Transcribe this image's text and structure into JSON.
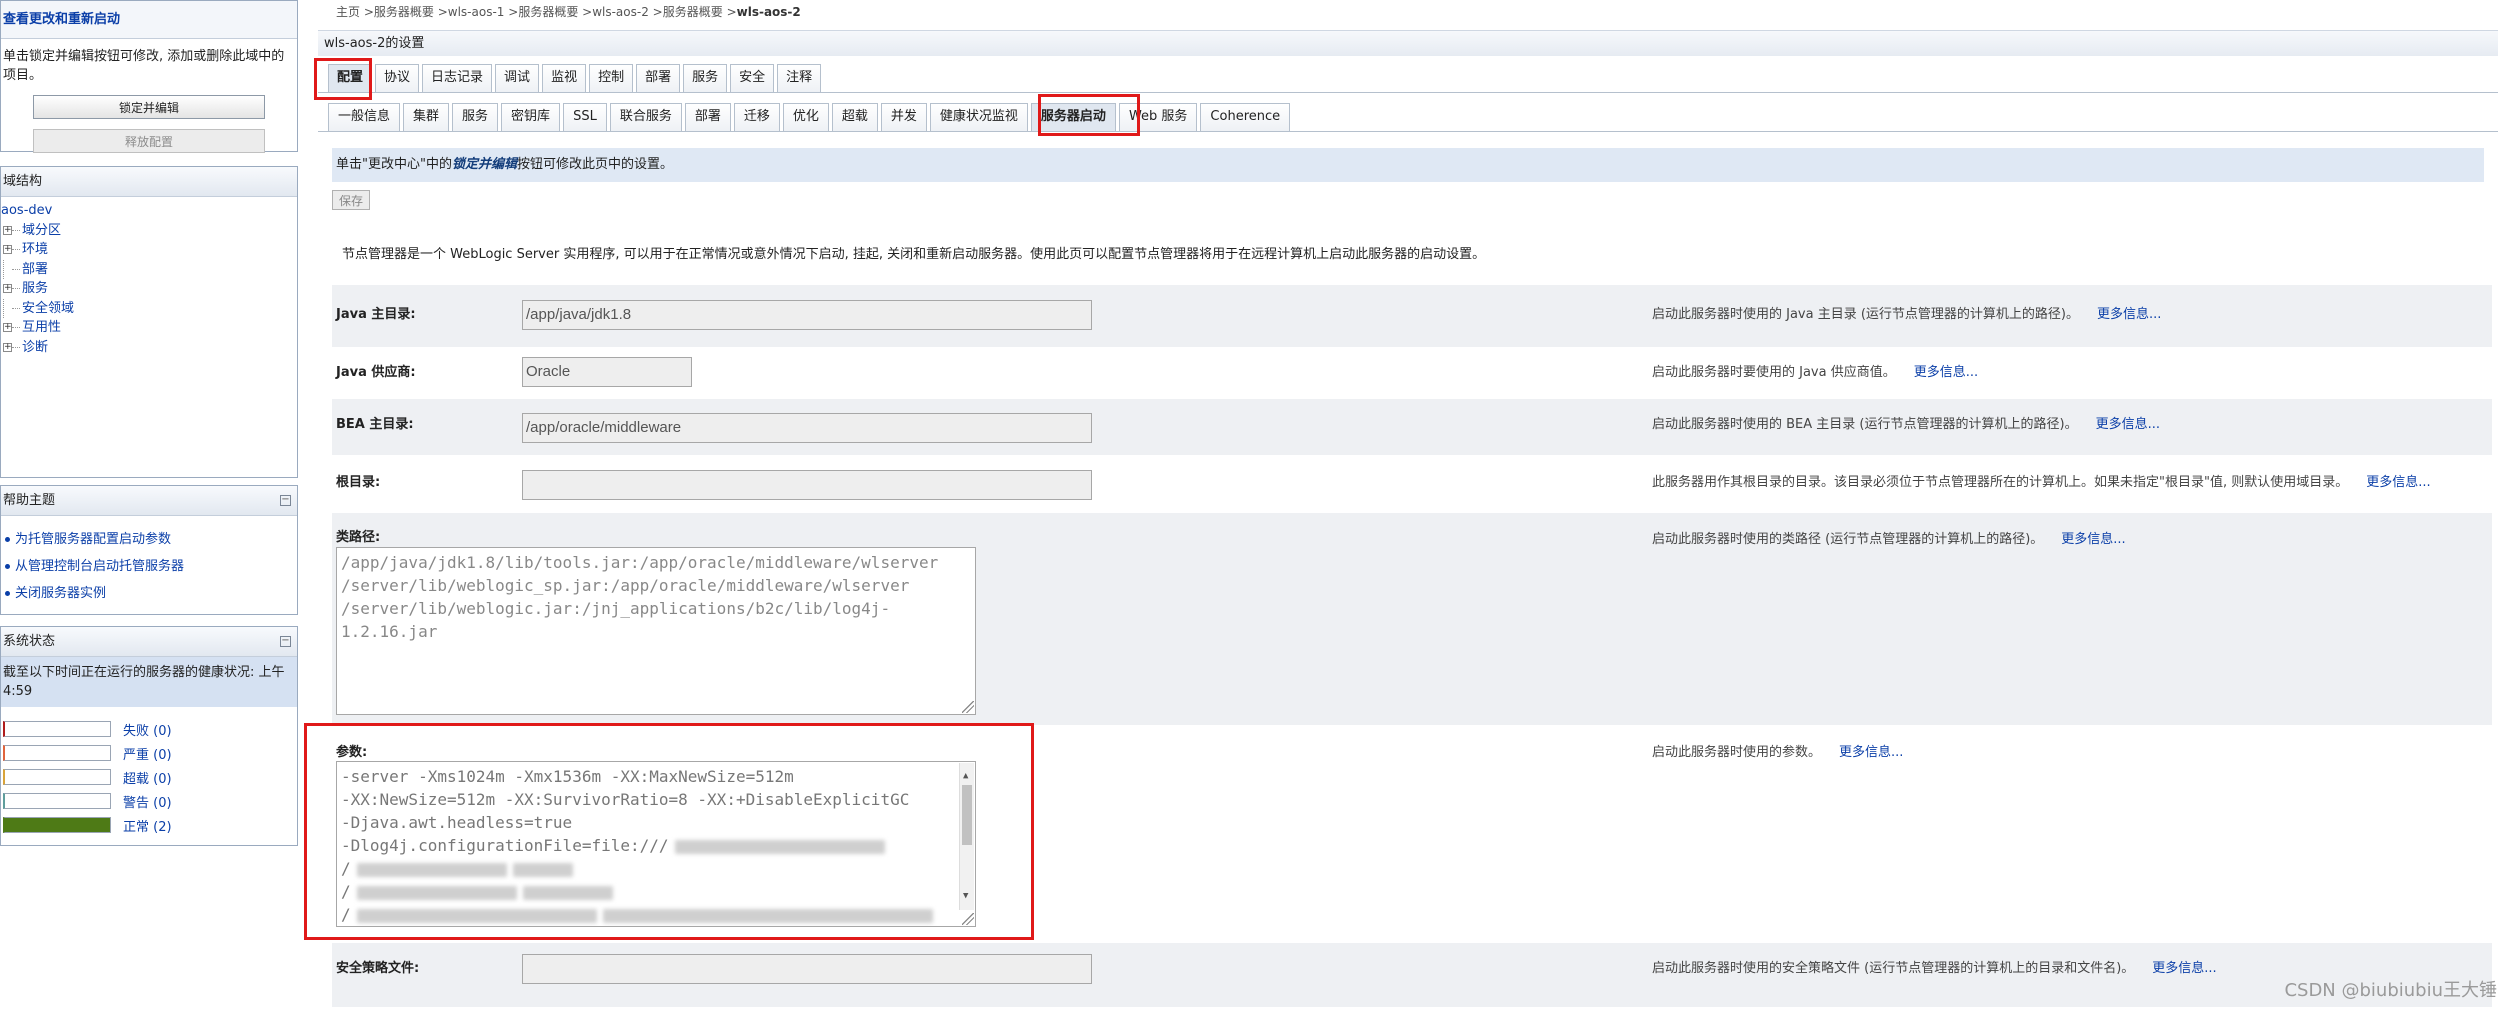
{
  "left": {
    "change_center": {
      "heading": "查看更改和重新启动",
      "text": "单击锁定并编辑按钮可修改, 添加或删除此域中的项目。",
      "lock_edit_label": "锁定并编辑",
      "release_label": "释放配置"
    },
    "domain_structure": {
      "heading": "域结构",
      "root": "aos-dev",
      "items": [
        {
          "label": "域分区",
          "expandable": true
        },
        {
          "label": "环境",
          "expandable": true
        },
        {
          "label": "部署",
          "expandable": false
        },
        {
          "label": "服务",
          "expandable": true
        },
        {
          "label": "安全领域",
          "expandable": false
        },
        {
          "label": "互用性",
          "expandable": true
        },
        {
          "label": "诊断",
          "expandable": true
        }
      ]
    },
    "help": {
      "heading": "帮助主题",
      "collapse_glyph": "⊟",
      "links": [
        "为托管服务器配置启动参数",
        "从管理控制台启动托管服务器",
        "关闭服务器实例"
      ]
    },
    "system_status": {
      "heading": "系统状态",
      "collapse_glyph": "⊟",
      "description": "截至以下时间正在运行的服务器的健康状况: 上午4:59",
      "rows": [
        {
          "label": "失败 (0)",
          "color": "#b01c1c",
          "fill": 0
        },
        {
          "label": "严重 (0)",
          "color": "#e0643c",
          "fill": 0
        },
        {
          "label": "超载 (0)",
          "color": "#d9a43a",
          "fill": 0
        },
        {
          "label": "警告 (0)",
          "color": "#5f9e9c",
          "fill": 0
        },
        {
          "label": "正常 (2)",
          "color": "#4e7a16",
          "fill": 1
        }
      ]
    }
  },
  "main": {
    "breadcrumb": {
      "parts": [
        "主页",
        "服务器概要",
        "wls-aos-1",
        "服务器概要",
        "wls-aos-2",
        "服务器概要"
      ],
      "current": "wls-aos-2"
    },
    "page_title": "wls-aos-2的设置",
    "tabs_primary": [
      "配置",
      "协议",
      "日志记录",
      "调试",
      "监视",
      "控制",
      "部署",
      "服务",
      "安全",
      "注释"
    ],
    "tabs_secondary": [
      "一般信息",
      "集群",
      "服务",
      "密钥库",
      "SSL",
      "联合服务",
      "部署",
      "迁移",
      "优化",
      "超载",
      "并发",
      "健康状况监视",
      "服务器启动",
      "Web 服务",
      "Coherence"
    ],
    "notice": {
      "prefix": "单击\"更改中心\"中的",
      "emph": "锁定并编辑",
      "suffix": "按钮可修改此页中的设置。"
    },
    "save_label": "保存",
    "intro": "节点管理器是一个 WebLogic Server 实用程序, 可以用于在正常情况或意外情况下启动, 挂起, 关闭和重新启动服务器。使用此页可以配置节点管理器将用于在远程计算机上启动此服务器的启动设置。",
    "more_info": "更多信息...",
    "fields": {
      "java_home": {
        "label": "Java 主目录:",
        "value": "/app/java/jdk1.8",
        "desc": "启动此服务器时使用的 Java 主目录 (运行节点管理器的计算机上的路径)。"
      },
      "java_vendor": {
        "label": "Java 供应商:",
        "value": "Oracle",
        "desc": "启动此服务器时要使用的 Java 供应商值。"
      },
      "bea_home": {
        "label": "BEA 主目录:",
        "value": "/app/oracle/middleware",
        "desc": "启动此服务器时使用的 BEA 主目录 (运行节点管理器的计算机上的路径)。"
      },
      "root_dir": {
        "label": "根目录:",
        "value": "",
        "desc": "此服务器用作其根目录的目录。该目录必须位于节点管理器所在的计算机上。如果未指定\"根目录\"值, 则默认使用域目录。"
      },
      "classpath": {
        "label": "类路径:",
        "lines": [
          "/app/java/jdk1.8/lib/tools.jar:/app/oracle/middleware/wlserver",
          "/server/lib/weblogic_sp.jar:/app/oracle/middleware/wlserver",
          "/server/lib/weblogic.jar:/jnj_applications/b2c/lib/log4j-",
          "1.2.16.jar"
        ],
        "desc": "启动此服务器时使用的类路径 (运行节点管理器的计算机上的路径)。"
      },
      "arguments": {
        "label": "参数:",
        "lines": [
          "-server -Xms1024m -Xmx1536m -XX:MaxNewSize=512m",
          "-XX:NewSize=512m -XX:SurvivorRatio=8 -XX:+DisableExplicitGC",
          "-Djava.awt.headless=true",
          "-Dlog4j.configurationFile=file:///"
        ],
        "desc": "启动此服务器时使用的参数。"
      },
      "security_policy": {
        "label": "安全策略文件:",
        "value": "",
        "desc": "启动此服务器时使用的安全策略文件 (运行节点管理器的计算机上的目录和文件名)。"
      }
    }
  },
  "watermark": "CSDN @biubiubiu王大锤",
  "colors": {
    "highlight": "#e01919",
    "link": "#0b3fa8",
    "notice_bg": "#dfe8f4"
  }
}
